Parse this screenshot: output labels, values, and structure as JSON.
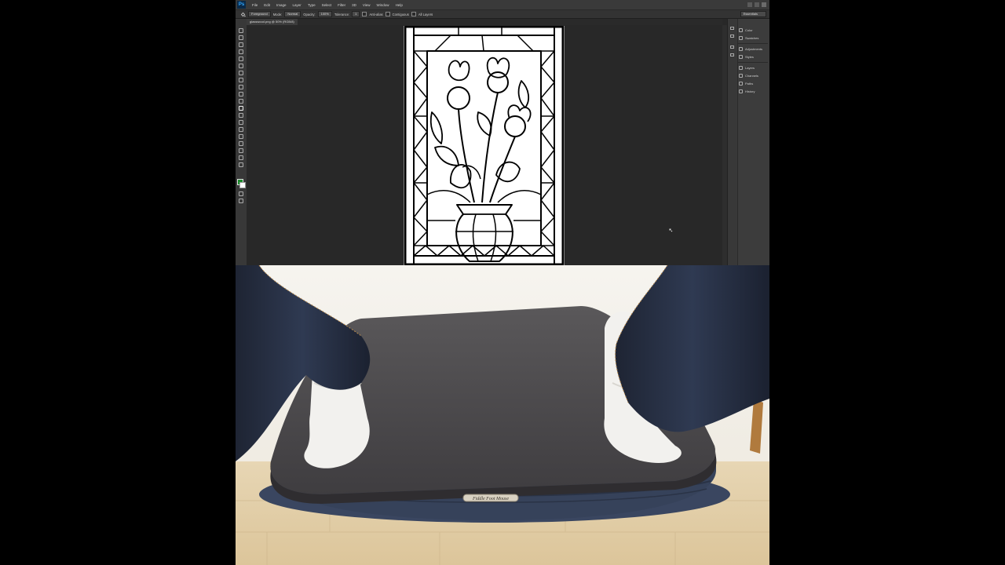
{
  "app": {
    "logo": "Ps",
    "menu": [
      "File",
      "Edit",
      "Image",
      "Layer",
      "Type",
      "Select",
      "Filter",
      "3D",
      "View",
      "Window",
      "Help"
    ]
  },
  "options": {
    "fill_source": "Foreground",
    "mode_label": "Mode:",
    "mode_value": "Normal",
    "opacity_label": "Opacity:",
    "opacity_value": "100%",
    "tolerance_label": "Tolerance:",
    "tolerance_value": "1",
    "anti_alias": "Anti-alias",
    "contiguous": "Contiguous",
    "all_layers": "All Layers",
    "workspace": "Essentials"
  },
  "document": {
    "tab_title": "glasswood.png @ 50% (RGB/8)"
  },
  "panels": {
    "group1": [
      "Color",
      "Swatches"
    ],
    "group2": [
      "Adjustments",
      "Styles"
    ],
    "group3": [
      "Layers",
      "Channels",
      "Paths",
      "History"
    ]
  },
  "colors": {
    "foreground": "#1a8a2b",
    "background": "#ffffff",
    "workspace_bg": "#282828",
    "panel_bg": "#3c3c3c"
  },
  "photo": {
    "plate_text": "Fiddle Foot Mouse"
  }
}
